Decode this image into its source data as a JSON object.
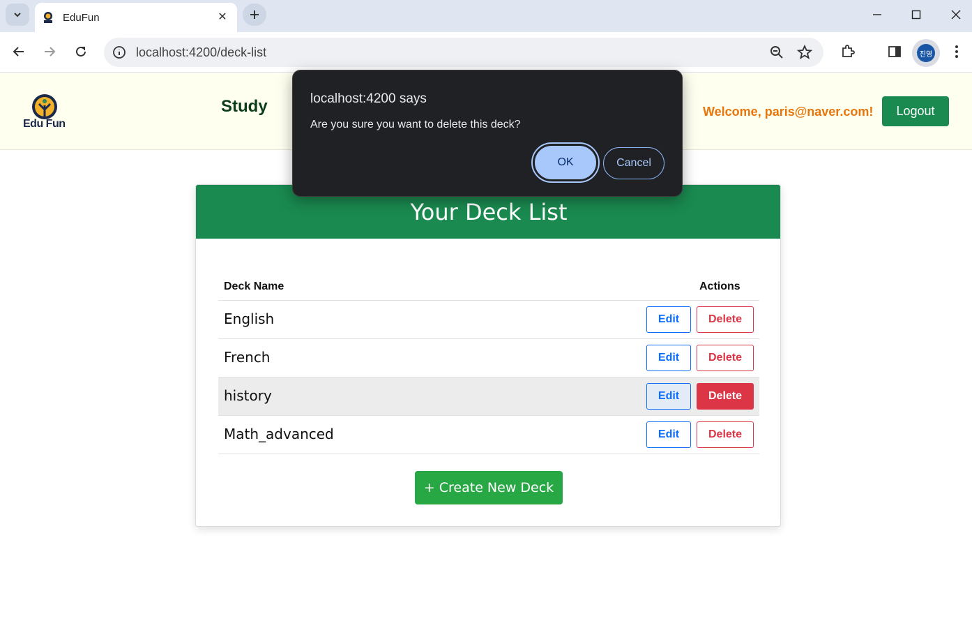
{
  "browser": {
    "tab_title": "EduFun",
    "url": "localhost:4200/deck-list",
    "profile_initials": "진영"
  },
  "header": {
    "logo_text": "Edu Fun",
    "nav_study": "Study",
    "welcome": "Welcome, paris@naver.com!",
    "logout": "Logout"
  },
  "deck_list": {
    "title": "Your Deck List",
    "col_name": "Deck Name",
    "col_actions": "Actions",
    "rows": [
      {
        "name": "English",
        "edit": "Edit",
        "delete": "Delete"
      },
      {
        "name": "French",
        "edit": "Edit",
        "delete": "Delete"
      },
      {
        "name": "history",
        "edit": "Edit",
        "delete": "Delete"
      },
      {
        "name": "Math_advanced",
        "edit": "Edit",
        "delete": "Delete"
      }
    ],
    "create_button": "+ Create New Deck"
  },
  "dialog": {
    "title": "localhost:4200 says",
    "message": "Are you sure you want to delete this deck?",
    "ok": "OK",
    "cancel": "Cancel"
  },
  "colors": {
    "brand_green": "#1a8a50",
    "create_green": "#28a745",
    "danger": "#dc3545",
    "primary": "#0d6efd",
    "welcome_orange": "#e8760c"
  }
}
